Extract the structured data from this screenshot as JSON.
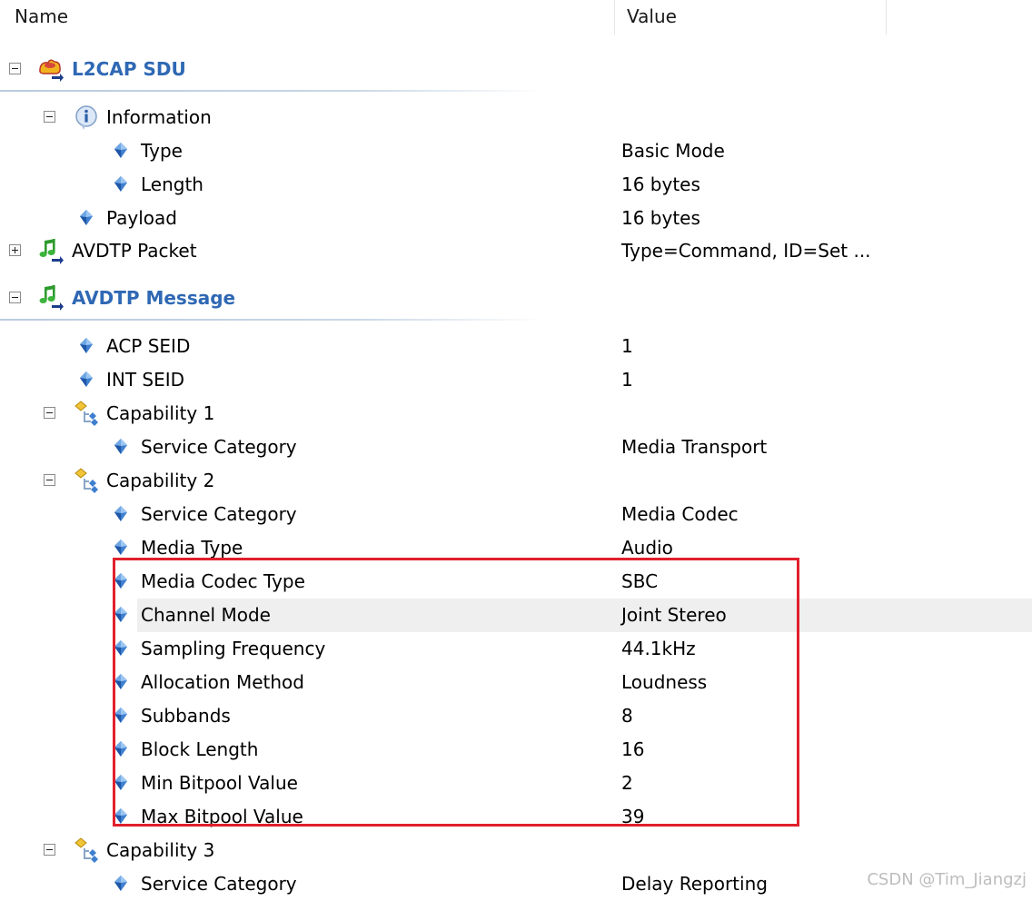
{
  "header": {
    "name_label": "Name",
    "value_label": "Value"
  },
  "rows": [
    {
      "label": "L2CAP SDU",
      "value": "",
      "icon": "l2cap-sdu-icon",
      "toggle": "collapse",
      "group": true
    },
    {
      "label": "Information",
      "value": "",
      "icon": "info-icon",
      "toggle": "collapse"
    },
    {
      "label": "Type",
      "value": "Basic Mode",
      "icon": "field-diamond-icon"
    },
    {
      "label": "Length",
      "value": "16 bytes",
      "icon": "field-diamond-icon"
    },
    {
      "label": "Payload",
      "value": "16 bytes",
      "icon": "field-diamond-icon"
    },
    {
      "label": "AVDTP Packet",
      "value": "Type=Command, ID=Set ...",
      "icon": "music-note-icon",
      "toggle": "expand"
    },
    {
      "label": "AVDTP Message",
      "value": "",
      "icon": "music-note-icon",
      "toggle": "collapse",
      "group": true
    },
    {
      "label": "ACP SEID",
      "value": "1",
      "icon": "field-diamond-icon"
    },
    {
      "label": "INT SEID",
      "value": "1",
      "icon": "field-diamond-icon"
    },
    {
      "label": "Capability 1",
      "value": "",
      "icon": "capability-icon",
      "toggle": "collapse"
    },
    {
      "label": "Service Category",
      "value": "Media Transport",
      "icon": "field-diamond-icon"
    },
    {
      "label": "Capability 2",
      "value": "",
      "icon": "capability-icon",
      "toggle": "collapse"
    },
    {
      "label": "Service Category",
      "value": "Media Codec",
      "icon": "field-diamond-icon"
    },
    {
      "label": "Media Type",
      "value": "Audio",
      "icon": "field-diamond-icon"
    },
    {
      "label": "Media Codec Type",
      "value": "SBC",
      "icon": "field-diamond-icon"
    },
    {
      "label": "Channel Mode",
      "value": "Joint Stereo",
      "icon": "field-diamond-icon",
      "selected": true
    },
    {
      "label": "Sampling Frequency",
      "value": "44.1kHz",
      "icon": "field-diamond-icon"
    },
    {
      "label": "Allocation Method",
      "value": "Loudness",
      "icon": "field-diamond-icon"
    },
    {
      "label": "Subbands",
      "value": "8",
      "icon": "field-diamond-icon"
    },
    {
      "label": "Block Length",
      "value": "16",
      "icon": "field-diamond-icon"
    },
    {
      "label": "Min Bitpool Value",
      "value": "2",
      "icon": "field-diamond-icon"
    },
    {
      "label": "Max Bitpool Value",
      "value": "39",
      "icon": "field-diamond-icon"
    },
    {
      "label": "Capability 3",
      "value": "",
      "icon": "capability-icon",
      "toggle": "collapse"
    },
    {
      "label": "Service Category",
      "value": "Delay Reporting",
      "icon": "field-diamond-icon"
    }
  ],
  "colors": {
    "group_label": "#2f68b4",
    "highlight_box": "#e0202b",
    "selected_row": "#efefef"
  },
  "watermark": "CSDN @Tim_Jiangzj"
}
